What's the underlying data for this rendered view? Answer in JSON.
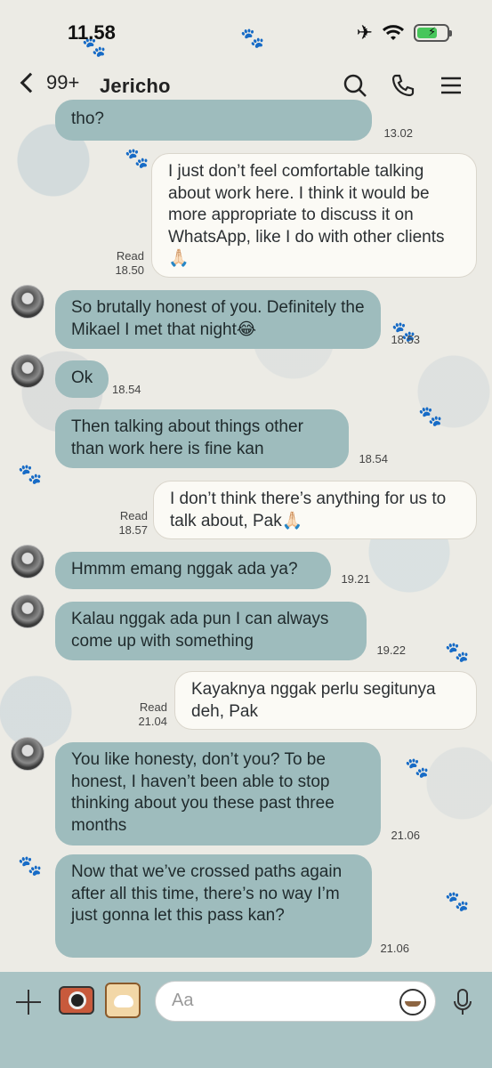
{
  "status_bar": {
    "time": "11.58"
  },
  "header": {
    "back_count": "99+",
    "contact_name": "Jericho"
  },
  "messages": [
    {
      "dir": "in",
      "text": "tho?",
      "time": "13.02"
    },
    {
      "dir": "out",
      "text": "I just don’t feel comfortable talking about work here. I think it would be more appropriate to discuss it on WhatsApp, like I do with other clients🙏🏻",
      "read": "Read",
      "time": "18.50"
    },
    {
      "dir": "in",
      "text": "So brutally honest of you. Definitely the Mikael I met that night😂",
      "time": "18.53"
    },
    {
      "dir": "in",
      "text": "Ok",
      "time": "18.54"
    },
    {
      "dir": "in",
      "text": "Then talking about things other than work here is fine kan",
      "time": "18.54"
    },
    {
      "dir": "out",
      "text": "I don’t think there’s anything for us to talk about, Pak🙏🏻",
      "read": "Read",
      "time": "18.57"
    },
    {
      "dir": "in",
      "text": "Hmmm emang nggak ada ya?",
      "time": "19.21"
    },
    {
      "dir": "in",
      "text": "Kalau nggak ada pun I can always come up with something",
      "time": "19.22"
    },
    {
      "dir": "out",
      "text": "Kayaknya nggak perlu segitunya deh, Pak",
      "read": "Read",
      "time": "21.04"
    },
    {
      "dir": "in",
      "text": "You like honesty, don’t you? To be honest, I haven’t been able to stop thinking about you these past three months",
      "time": "21.06"
    },
    {
      "dir": "in",
      "text": "Now that we’ve crossed paths again after all this time, there’s no way I’m just gonna let this pass kan?",
      "time": "21.06"
    }
  ],
  "composer": {
    "placeholder": "Aa"
  },
  "icons": {
    "status": [
      "airplane-icon",
      "wifi-icon",
      "battery-icon"
    ],
    "header": [
      "search-icon",
      "phone-icon",
      "menu-icon"
    ],
    "composer": [
      "plus-icon",
      "camera-icon",
      "sticker-icon",
      "emoji-icon",
      "microphone-icon"
    ]
  },
  "colors": {
    "incoming_bubble": "#9ebcbd",
    "outgoing_bubble": "#fbfaf5",
    "composer_bg": "#a9c3c4"
  }
}
